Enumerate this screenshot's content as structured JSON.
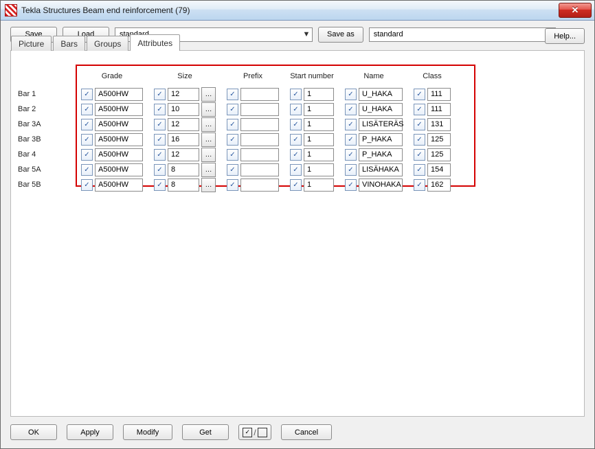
{
  "window": {
    "title": "Tekla Structures  Beam end reinforcement (79)"
  },
  "toolbar": {
    "save": "Save",
    "load": "Load",
    "profile_combo": "standard",
    "save_as": "Save as",
    "save_as_name": "standard",
    "help": "Help..."
  },
  "tabs": {
    "picture": "Picture",
    "bars": "Bars",
    "groups": "Groups",
    "attributes": "Attributes"
  },
  "columns": {
    "grade": "Grade",
    "size": "Size",
    "prefix": "Prefix",
    "start": "Start number",
    "name": "Name",
    "class": "Class"
  },
  "rows": [
    {
      "label": "Bar 1",
      "grade": "A500HW",
      "size": "12",
      "prefix": "",
      "start": "1",
      "name": "U_HAKA",
      "class": "111"
    },
    {
      "label": "Bar 2",
      "grade": "A500HW",
      "size": "10",
      "prefix": "",
      "start": "1",
      "name": "U_HAKA",
      "class": "111"
    },
    {
      "label": "Bar 3A",
      "grade": "A500HW",
      "size": "12",
      "prefix": "",
      "start": "1",
      "name": "LISÄTERÄS",
      "class": "131"
    },
    {
      "label": "Bar 3B",
      "grade": "A500HW",
      "size": "16",
      "prefix": "",
      "start": "1",
      "name": "P_HAKA",
      "class": "125"
    },
    {
      "label": "Bar 4",
      "grade": "A500HW",
      "size": "12",
      "prefix": "",
      "start": "1",
      "name": "P_HAKA",
      "class": "125"
    },
    {
      "label": "Bar 5A",
      "grade": "A500HW",
      "size": "8",
      "prefix": "",
      "start": "1",
      "name": "LISÄHAKA",
      "class": "154"
    },
    {
      "label": "Bar 5B",
      "grade": "A500HW",
      "size": "8",
      "prefix": "",
      "start": "1",
      "name": "VINOHAKA",
      "class": "162"
    }
  ],
  "footer": {
    "ok": "OK",
    "apply": "Apply",
    "modify": "Modify",
    "get": "Get",
    "cancel": "Cancel"
  }
}
